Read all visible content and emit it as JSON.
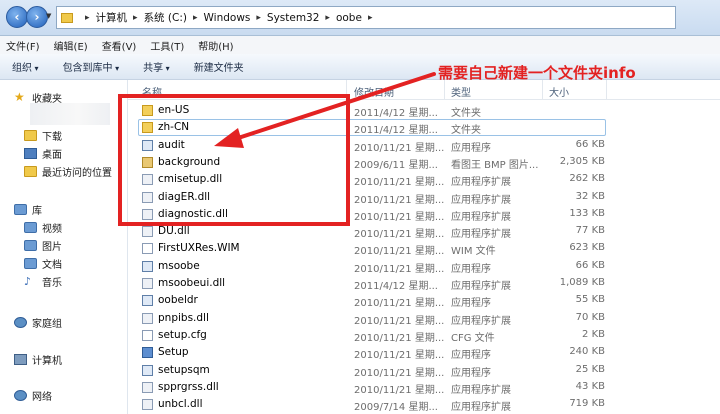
{
  "address": {
    "crumbs": [
      "计算机",
      "系统 (C:)",
      "Windows",
      "System32",
      "oobe"
    ]
  },
  "menu": [
    "文件(F)",
    "编辑(E)",
    "查看(V)",
    "工具(T)",
    "帮助(H)"
  ],
  "toolbar": {
    "organize": "组织",
    "include_in_library": "包含到库中",
    "share": "共享",
    "new_folder": "新建文件夹"
  },
  "nav": {
    "favorites": "收藏夹",
    "downloads": "下载",
    "desktop": "桌面",
    "recent": "最近访问的位置",
    "libraries": "库",
    "videos": "视频",
    "pictures": "图片",
    "documents": "文档",
    "music": "音乐",
    "homegroup": "家庭组",
    "computer": "计算机",
    "network": "网络"
  },
  "columns": {
    "name": "名称",
    "date": "修改日期",
    "type": "类型",
    "size": "大小"
  },
  "files": [
    {
      "name": "en-US",
      "date": "2011/4/12 星期...",
      "type": "文件夹",
      "size": "",
      "icon": "folder"
    },
    {
      "name": "zh-CN",
      "date": "2011/4/12 星期...",
      "type": "文件夹",
      "size": "",
      "icon": "folder"
    },
    {
      "name": "audit",
      "date": "2010/11/21 星期...",
      "type": "应用程序",
      "size": "66 KB",
      "icon": "exe"
    },
    {
      "name": "background",
      "date": "2009/6/11 星期...",
      "type": "看图王 BMP 图片...",
      "size": "2,305 KB",
      "icon": "bmp"
    },
    {
      "name": "cmisetup.dll",
      "date": "2010/11/21 星期...",
      "type": "应用程序扩展",
      "size": "262 KB",
      "icon": "dll"
    },
    {
      "name": "diagER.dll",
      "date": "2010/11/21 星期...",
      "type": "应用程序扩展",
      "size": "32 KB",
      "icon": "dll"
    },
    {
      "name": "diagnostic.dll",
      "date": "2010/11/21 星期...",
      "type": "应用程序扩展",
      "size": "133 KB",
      "icon": "dll"
    },
    {
      "name": "DU.dll",
      "date": "2010/11/21 星期...",
      "type": "应用程序扩展",
      "size": "77 KB",
      "icon": "dll"
    },
    {
      "name": "FirstUXRes.WIM",
      "date": "2010/11/21 星期...",
      "type": "WIM 文件",
      "size": "623 KB",
      "icon": "file"
    },
    {
      "name": "msoobe",
      "date": "2010/11/21 星期...",
      "type": "应用程序",
      "size": "66 KB",
      "icon": "exe"
    },
    {
      "name": "msoobeui.dll",
      "date": "2011/4/12 星期...",
      "type": "应用程序扩展",
      "size": "1,089 KB",
      "icon": "dll"
    },
    {
      "name": "oobeldr",
      "date": "2010/11/21 星期...",
      "type": "应用程序",
      "size": "55 KB",
      "icon": "exe"
    },
    {
      "name": "pnpibs.dll",
      "date": "2010/11/21 星期...",
      "type": "应用程序扩展",
      "size": "70 KB",
      "icon": "dll"
    },
    {
      "name": "setup.cfg",
      "date": "2010/11/21 星期...",
      "type": "CFG 文件",
      "size": "2 KB",
      "icon": "file"
    },
    {
      "name": "Setup",
      "date": "2010/11/21 星期...",
      "type": "应用程序",
      "size": "240 KB",
      "icon": "blue"
    },
    {
      "name": "setupsqm",
      "date": "2010/11/21 星期...",
      "type": "应用程序",
      "size": "25 KB",
      "icon": "exe"
    },
    {
      "name": "spprgrss.dll",
      "date": "2010/11/21 星期...",
      "type": "应用程序扩展",
      "size": "43 KB",
      "icon": "dll"
    },
    {
      "name": "unbcl.dll",
      "date": "2009/7/14 星期...",
      "type": "应用程序扩展",
      "size": "719 KB",
      "icon": "dll"
    }
  ],
  "annotation": {
    "text": "需要自己新建一个文件夹info",
    "color": "#e32222"
  }
}
